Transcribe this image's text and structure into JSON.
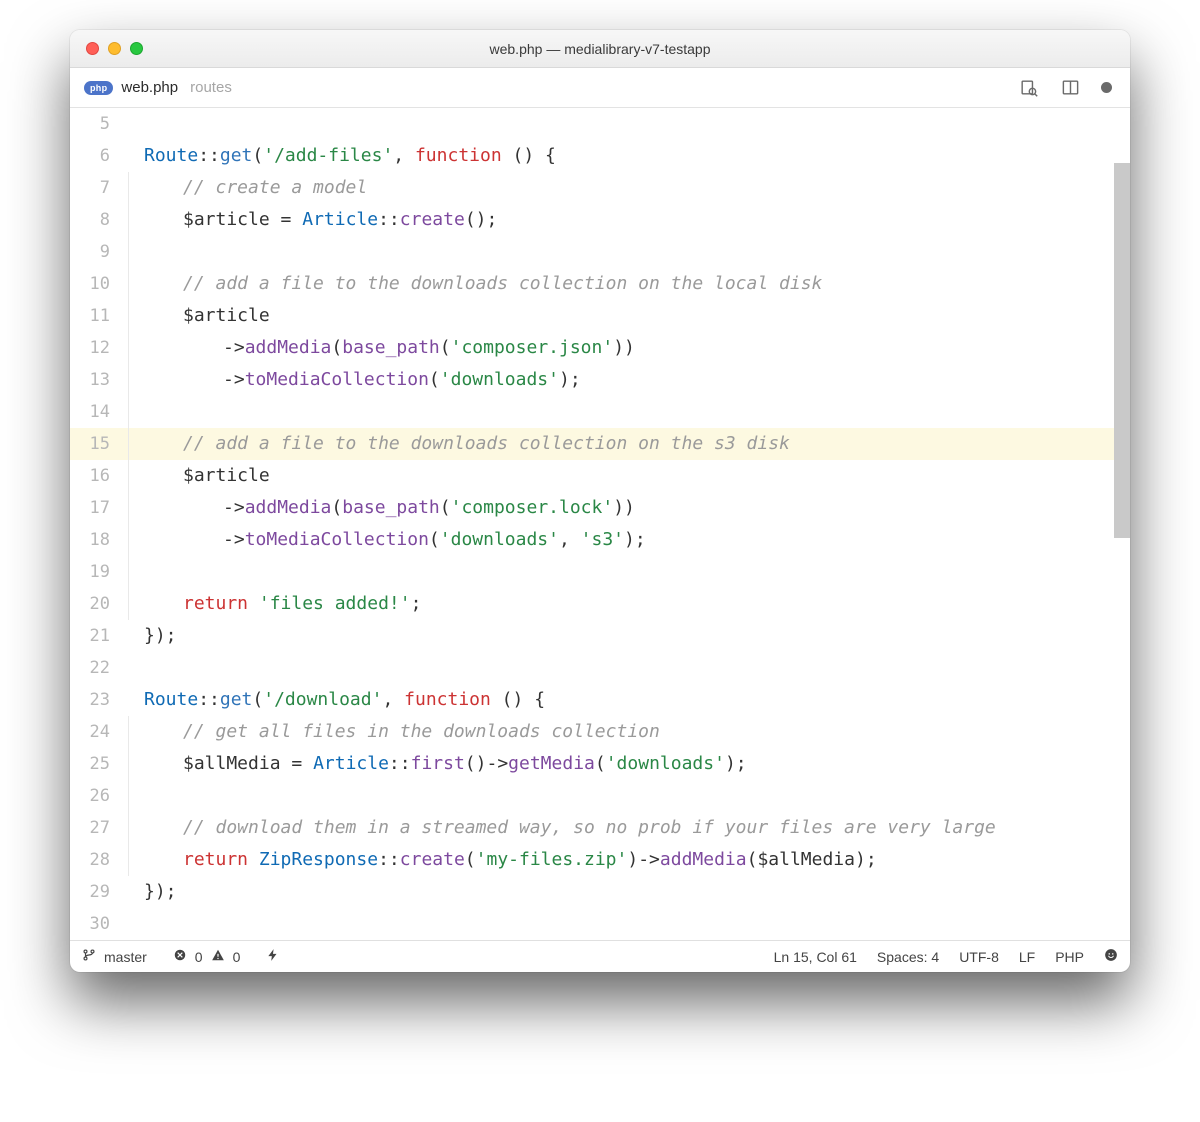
{
  "window": {
    "title": "web.php — medialibrary-v7-testapp"
  },
  "tab": {
    "badge": "php",
    "filename": "web.php",
    "folder": "routes"
  },
  "status": {
    "branch": "master",
    "errors": "0",
    "warnings": "0",
    "cursor": "Ln 15, Col 61",
    "spaces": "Spaces: 4",
    "encoding": "UTF-8",
    "eol": "LF",
    "lang": "PHP"
  },
  "code_lines": [
    {
      "n": 5,
      "indent": 0,
      "tokens": []
    },
    {
      "n": 6,
      "indent": 0,
      "tokens": [
        [
          "c-class",
          "Route"
        ],
        [
          "c-op",
          "::"
        ],
        [
          "c-method",
          "get"
        ],
        [
          "c-punc",
          "("
        ],
        [
          "c-string",
          "'/add-files'"
        ],
        [
          "c-punc",
          ", "
        ],
        [
          "c-keyword",
          "function"
        ],
        [
          "c-punc",
          " () {"
        ]
      ]
    },
    {
      "n": 7,
      "indent": 1,
      "tokens": [
        [
          "c-comment",
          "// create a model"
        ]
      ]
    },
    {
      "n": 8,
      "indent": 1,
      "tokens": [
        [
          "c-var",
          "$article "
        ],
        [
          "c-op",
          "= "
        ],
        [
          "c-class",
          "Article"
        ],
        [
          "c-op",
          "::"
        ],
        [
          "c-call",
          "create"
        ],
        [
          "c-punc",
          "();"
        ]
      ]
    },
    {
      "n": 9,
      "indent": 1,
      "tokens": []
    },
    {
      "n": 10,
      "indent": 1,
      "tokens": [
        [
          "c-comment",
          "// add a file to the downloads collection on the local disk"
        ]
      ]
    },
    {
      "n": 11,
      "indent": 1,
      "tokens": [
        [
          "c-var",
          "$article"
        ]
      ]
    },
    {
      "n": 12,
      "indent": 2,
      "tokens": [
        [
          "c-op",
          "->"
        ],
        [
          "c-call",
          "addMedia"
        ],
        [
          "c-punc",
          "("
        ],
        [
          "c-call",
          "base_path"
        ],
        [
          "c-punc",
          "("
        ],
        [
          "c-string",
          "'composer.json'"
        ],
        [
          "c-punc",
          "))"
        ]
      ]
    },
    {
      "n": 13,
      "indent": 2,
      "tokens": [
        [
          "c-op",
          "->"
        ],
        [
          "c-call",
          "toMediaCollection"
        ],
        [
          "c-punc",
          "("
        ],
        [
          "c-string",
          "'downloads'"
        ],
        [
          "c-punc",
          ");"
        ]
      ]
    },
    {
      "n": 14,
      "indent": 1,
      "tokens": []
    },
    {
      "n": 15,
      "indent": 1,
      "hl": true,
      "tokens": [
        [
          "c-comment",
          "// add a file to the downloads collection on the s3 disk"
        ]
      ]
    },
    {
      "n": 16,
      "indent": 1,
      "tokens": [
        [
          "c-var",
          "$article"
        ]
      ]
    },
    {
      "n": 17,
      "indent": 2,
      "tokens": [
        [
          "c-op",
          "->"
        ],
        [
          "c-call",
          "addMedia"
        ],
        [
          "c-punc",
          "("
        ],
        [
          "c-call",
          "base_path"
        ],
        [
          "c-punc",
          "("
        ],
        [
          "c-string",
          "'composer.lock'"
        ],
        [
          "c-punc",
          "))"
        ]
      ]
    },
    {
      "n": 18,
      "indent": 2,
      "tokens": [
        [
          "c-op",
          "->"
        ],
        [
          "c-call",
          "toMediaCollection"
        ],
        [
          "c-punc",
          "("
        ],
        [
          "c-string",
          "'downloads'"
        ],
        [
          "c-punc",
          ", "
        ],
        [
          "c-string",
          "'s3'"
        ],
        [
          "c-punc",
          ");"
        ]
      ]
    },
    {
      "n": 19,
      "indent": 1,
      "tokens": []
    },
    {
      "n": 20,
      "indent": 1,
      "tokens": [
        [
          "c-keyword",
          "return "
        ],
        [
          "c-string",
          "'files added!'"
        ],
        [
          "c-punc",
          ";"
        ]
      ]
    },
    {
      "n": 21,
      "indent": 0,
      "tokens": [
        [
          "c-punc",
          "});"
        ]
      ]
    },
    {
      "n": 22,
      "indent": 0,
      "tokens": []
    },
    {
      "n": 23,
      "indent": 0,
      "tokens": [
        [
          "c-class",
          "Route"
        ],
        [
          "c-op",
          "::"
        ],
        [
          "c-method",
          "get"
        ],
        [
          "c-punc",
          "("
        ],
        [
          "c-string",
          "'/download'"
        ],
        [
          "c-punc",
          ", "
        ],
        [
          "c-keyword",
          "function"
        ],
        [
          "c-punc",
          " () {"
        ]
      ]
    },
    {
      "n": 24,
      "indent": 1,
      "tokens": [
        [
          "c-comment",
          "// get all files in the downloads collection"
        ]
      ]
    },
    {
      "n": 25,
      "indent": 1,
      "tokens": [
        [
          "c-var",
          "$allMedia "
        ],
        [
          "c-op",
          "= "
        ],
        [
          "c-class",
          "Article"
        ],
        [
          "c-op",
          "::"
        ],
        [
          "c-call",
          "first"
        ],
        [
          "c-punc",
          "()"
        ],
        [
          "c-op",
          "->"
        ],
        [
          "c-call",
          "getMedia"
        ],
        [
          "c-punc",
          "("
        ],
        [
          "c-string",
          "'downloads'"
        ],
        [
          "c-punc",
          ");"
        ]
      ]
    },
    {
      "n": 26,
      "indent": 1,
      "tokens": []
    },
    {
      "n": 27,
      "indent": 1,
      "tokens": [
        [
          "c-comment",
          "// download them in a streamed way, so no prob if your files are very large"
        ]
      ]
    },
    {
      "n": 28,
      "indent": 1,
      "tokens": [
        [
          "c-keyword",
          "return "
        ],
        [
          "c-class",
          "ZipResponse"
        ],
        [
          "c-op",
          "::"
        ],
        [
          "c-call",
          "create"
        ],
        [
          "c-punc",
          "("
        ],
        [
          "c-string",
          "'my-files.zip'"
        ],
        [
          "c-punc",
          ")"
        ],
        [
          "c-op",
          "->"
        ],
        [
          "c-call",
          "addMedia"
        ],
        [
          "c-punc",
          "("
        ],
        [
          "c-var",
          "$allMedia"
        ],
        [
          "c-punc",
          ");"
        ]
      ]
    },
    {
      "n": 29,
      "indent": 0,
      "tokens": [
        [
          "c-punc",
          "});"
        ]
      ]
    },
    {
      "n": 30,
      "indent": 0,
      "tokens": []
    }
  ]
}
